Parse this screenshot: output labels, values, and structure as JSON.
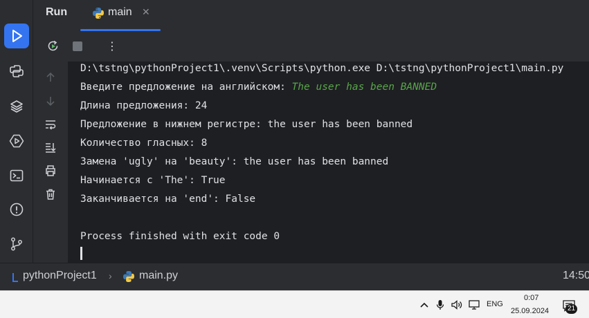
{
  "header": {
    "run_title": "Run",
    "tab_label": "main"
  },
  "console": {
    "command": "D:\\tstng\\pythonProject1\\.venv\\Scripts\\python.exe D:\\tstng\\pythonProject1\\main.py",
    "prompt": "Введите предложение на английском: ",
    "user_input": "The user has been BANNED",
    "lines": [
      "Длина предложения: 24",
      "Предложение в нижнем регистре: the user has been banned",
      "Количество гласных: 8",
      "Замена 'ugly' на 'beauty': the user has been banned",
      "Начинается с 'The': True",
      "Заканчивается на 'end': False"
    ],
    "exit_message": "Process finished with exit code 0"
  },
  "statusbar": {
    "project": "pythonProject1",
    "file": "main.py",
    "position": "14:50"
  },
  "taskbar": {
    "language": "ENG",
    "time": "0:07",
    "date": "25.09.2024",
    "notification_count": "21"
  },
  "colors": {
    "accent": "#3574f0",
    "user_input": "#57a64a",
    "rerun": "#5fb865"
  }
}
